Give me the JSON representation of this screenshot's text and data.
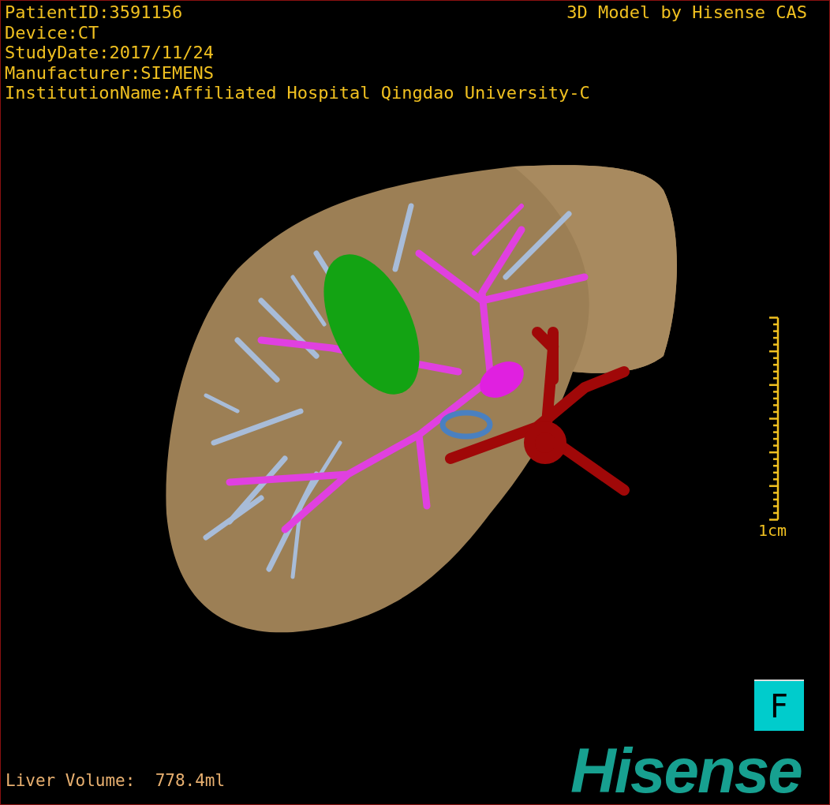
{
  "header_lines": [
    "PatientID:3591156",
    "Device:CT",
    "StudyDate:2017/11/24",
    "Manufacturer:SIEMENS",
    "InstitutionName:Affiliated Hospital Qingdao University-C"
  ],
  "model_credit": "3D Model by Hisense CAS",
  "scale_bar": {
    "label": "1cm"
  },
  "orientation": {
    "label": "F"
  },
  "footer": {
    "volume": "Liver Volume:  778.4ml"
  },
  "logo": "Hisense"
}
